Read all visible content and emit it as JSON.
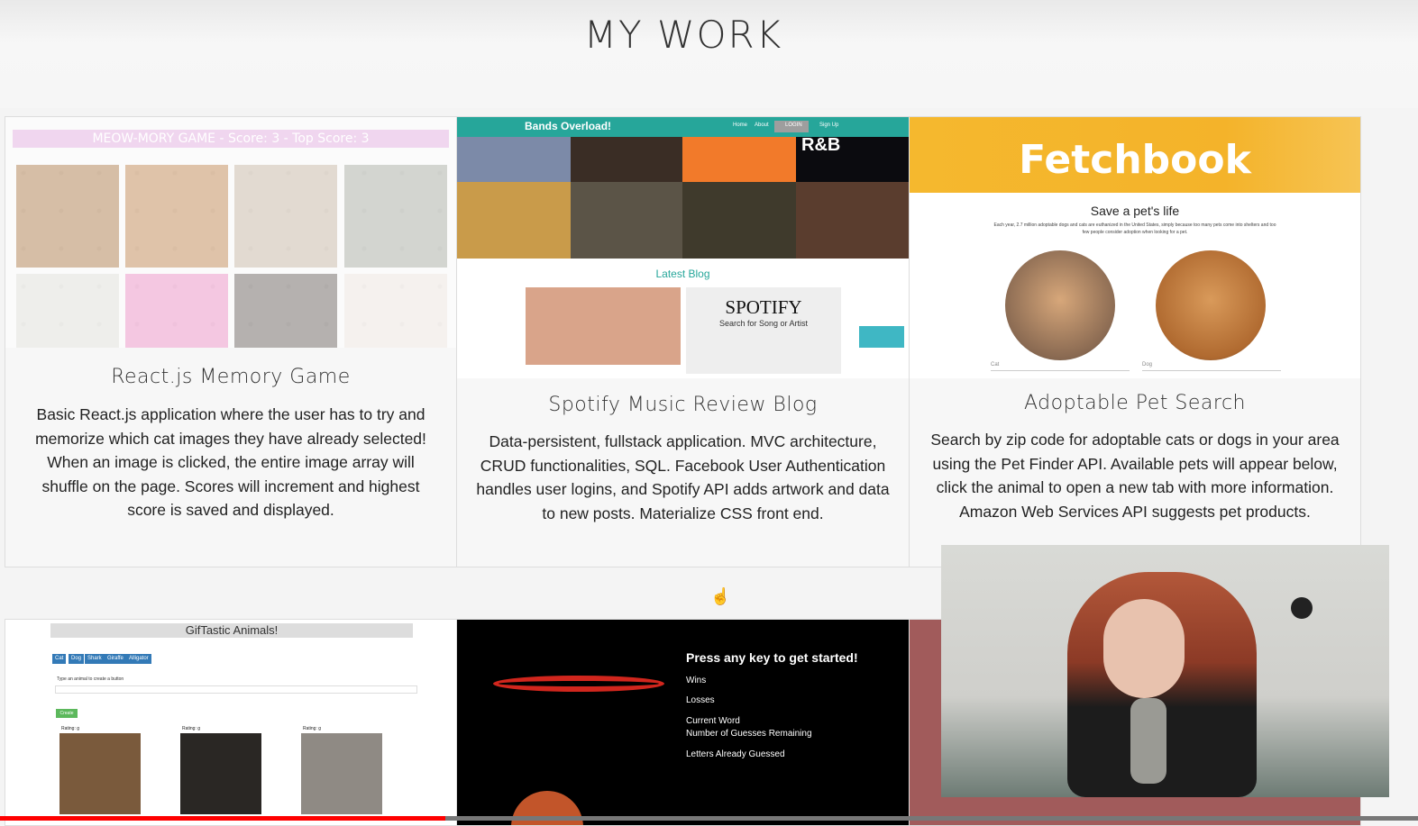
{
  "page": {
    "title": "MY WORK"
  },
  "projects": [
    {
      "title": "React.js Memory Game",
      "description": "Basic React.js application where the user has to try and memorize which cat images they have already selected! When an image is clicked, the entire image array will shuffle on the page. Scores will increment and highest score is saved and displayed.",
      "screenshot": {
        "bar_text": "MEOW-MORY GAME - Score: 3 - Top Score: 3"
      }
    },
    {
      "title": "Spotify Music Review Blog",
      "description": "Data-persistent, fullstack application. MVC architecture, CRUD functionalities, SQL. Facebook User Authentication handles user logins, and Spotify API adds artwork and data to new posts. Materialize CSS front end.",
      "screenshot": {
        "brand": "Bands Overload!",
        "nav": [
          "Home",
          "About",
          "LOGIN",
          "Sign Up"
        ],
        "genre": "R&B",
        "latest": "Latest Blog",
        "spotify_title": "SPOTIFY",
        "spotify_sub": "Search for Song or Artist"
      }
    },
    {
      "title": "Adoptable Pet Search",
      "description": "Search by zip code for adoptable cats or dogs in your area using the Pet Finder API. Available pets will appear below, click the animal to open a new tab with more information. Amazon Web Services API suggests pet products.",
      "screenshot": {
        "logo": "Fetchbook",
        "heading": "Save a pet's life",
        "small": "Each year, 2.7 million adoptable dogs and cats are euthanized in the United States, simply because too many pets come into shelters and too few people consider adoption when looking for a pet.",
        "select_cat": "Cat",
        "select_dog": "Dog"
      }
    },
    {
      "screenshot": {
        "title": "GifTastic Animals!",
        "buttons": [
          "Cat",
          "Dog",
          "Shark",
          "Giraffe",
          "Alligator"
        ],
        "hint": "Type an animal to create a button",
        "create": "Create",
        "rating": "Rating: g"
      }
    },
    {
      "screenshot": {
        "title": "Press any key to get started!",
        "lines": [
          "Wins",
          "Losses",
          "Current Word",
          "Number of Guesses Remaining",
          "Letters Already Guessed"
        ]
      }
    }
  ],
  "colors": {
    "accent_teal": "#26a69a",
    "fetch_yellow": "#f5b82e",
    "progress": "#ff0000"
  }
}
